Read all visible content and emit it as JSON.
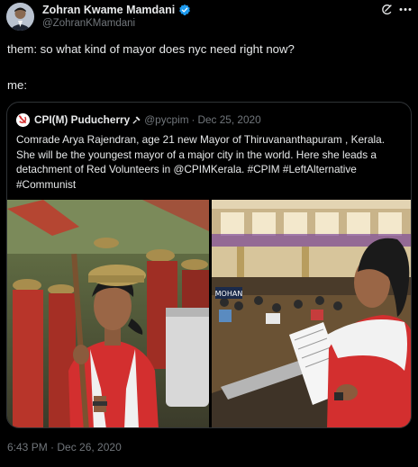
{
  "author": {
    "name": "Zohran Kwame Mamdani",
    "handle": "@ZohranKMamdani"
  },
  "tweet": {
    "line1": "them: so what kind of mayor does nyc need right now?",
    "line2": "me:",
    "timestamp": "6:43 PM · Dec 26, 2020"
  },
  "quote": {
    "name": "CPI(M) Puducherry",
    "handle": "@pycpim",
    "date": "Dec 25, 2020",
    "lines": [
      "Comrade Arya Rajendran, age 21  new Mayor of Thiruvananthapuram , Kerala.",
      "She will be the youngest mayor of a major city in the world. Here she leads a",
      "detachment of Red Volunteers in @CPIMKerala. #CPIM  #LeftAlternative",
      "#Communist"
    ],
    "image_text": {
      "sign_left": "MOHAN"
    }
  },
  "icons": {
    "avatar": "profile-photo",
    "verified": "verified-badge-icon",
    "grok": "grok-icon",
    "more": "more-horizontal-icon",
    "party_logo": "hammer-sickle-icon",
    "pin": "pin-icon"
  },
  "colors": {
    "background": "#000000",
    "text": "#e7e9ea",
    "muted": "#71767b",
    "border": "#2f3336",
    "verified": "#1d9bf0",
    "party_red": "#d32f2f"
  }
}
